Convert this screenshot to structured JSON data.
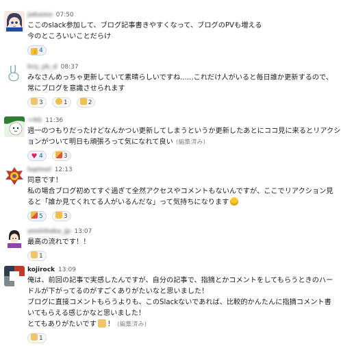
{
  "colors": {
    "link": "#1264a3",
    "reaction_bg": "#eef3fb",
    "text": "#1d1c1d",
    "meta": "#616061"
  },
  "messages": [
    {
      "name": "jakamo",
      "name_blurred": true,
      "time": "07:50",
      "avatar_icon": "anime-girl-avatar-icon",
      "lines": [
        "ここのslack参加して、ブログ記事書きやすくなって、ブログのPVも増える",
        "今のところいいことだらけ"
      ],
      "edited": "",
      "reactions": [
        {
          "icon": "thumbs-up-icon",
          "count": "4",
          "active": true
        }
      ]
    },
    {
      "name": "kry_yk_d",
      "name_blurred": true,
      "time": "08:37",
      "avatar_icon": "rabbit-avatar-icon",
      "lines": [
        "みなさんめっちゃ更新していて素晴らしいですね......これだけ人がいると毎日誰か更新するので、",
        "常にブログを意識させられます"
      ],
      "edited": "",
      "reactions": [
        {
          "icon": "flexed-biceps-icon",
          "count": "3",
          "active": false
        },
        {
          "icon": "smile-face-icon",
          "count": "1",
          "active": false
        },
        {
          "icon": "thumbs-up-icon",
          "count": "2",
          "active": false
        }
      ]
    },
    {
      "name": "+0G",
      "name_blurred": true,
      "time": "11:36",
      "avatar_icon": "green-character-avatar-icon",
      "lines": [
        "週一のつもりだったけどなんかつい更新してしまうというか更新したあとにココ見に来るとリアクシ",
        "ョンがついて明日も頑張ろって気になれて良い"
      ],
      "edited": "(編集済み)",
      "reactions": [
        {
          "icon": "heart-icon",
          "count": "4",
          "active": true
        },
        {
          "icon": "party-popper-icon",
          "count": "3",
          "active": false
        }
      ]
    },
    {
      "name": "lupinol",
      "name_blurred": true,
      "time": "12:13",
      "avatar_icon": "emblem-avatar-icon",
      "lines": [
        "同意です！",
        "私の場合ブログ初めてすぐ過ぎて全然アクセスやコメントもないんですが、ここでリアクション見",
        "ると「誰か見てくれてる人がいるんだな」って気持ちになります"
      ],
      "edited": "",
      "inline_emoji": "grinning-face-icon",
      "reactions": [
        {
          "icon": "party-popper-icon",
          "count": "5",
          "active": true
        },
        {
          "icon": "thumbs-up-icon",
          "count": "3",
          "active": false
        }
      ]
    },
    {
      "name": "yoshitaka_jp",
      "name_blurred": true,
      "time": "13:07",
      "avatar_icon": "person-avatar-icon",
      "lines": [
        "最高の流れです！！"
      ],
      "edited": "",
      "reactions": [
        {
          "icon": "clapping-hands-icon",
          "count": "1",
          "active": false
        }
      ]
    },
    {
      "name": "kojirock",
      "name_blurred": false,
      "time": "13:09",
      "avatar_icon": "geometric-avatar-icon",
      "lines": [
        "俺は、前回の記事で実感したんですが、自分の記事で、指摘とかコメントをしてもらうときのハー",
        "ドルが下がってるのがすごくありがたいなと思いました！",
        "ブログに直接コメントもらうよりも、このSlackないであれば、比較的かんたんに指摘コメント書",
        "いてもらえる感じかなと思いました！",
        "とてもありがたいです"
      ],
      "last_suffix": "！",
      "edited": "(編集済み)",
      "inline_emoji": "bowing-person-icon",
      "reactions": [
        {
          "icon": "raising-hands-icon",
          "count": "1",
          "active": false
        }
      ]
    }
  ]
}
